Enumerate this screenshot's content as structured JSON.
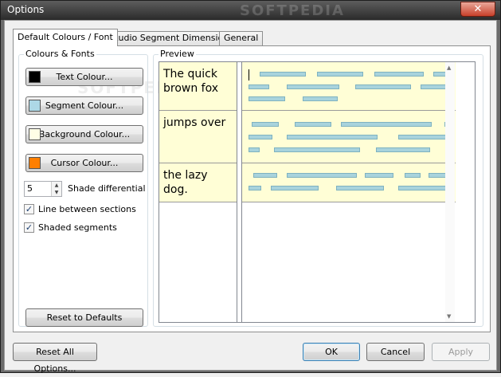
{
  "window": {
    "title": "Options",
    "close_symbol": "✕",
    "watermark": "SOFTPEDIA"
  },
  "tabs": [
    {
      "label": "Default Colours / Font",
      "active": true
    },
    {
      "label": "Audio Segment Dimensions",
      "active": false
    },
    {
      "label": "General",
      "active": false
    }
  ],
  "colours_group": {
    "label": "Colours & Fonts",
    "buttons": [
      {
        "label": "Text Colour...",
        "swatch": "#000000"
      },
      {
        "label": "Segment Colour...",
        "swatch": "#add8e6"
      },
      {
        "label": "Background Colour...",
        "swatch": "#fffee6"
      },
      {
        "label": "Cursor Colour...",
        "swatch": "#ff7f00"
      }
    ],
    "shade": {
      "value": "5",
      "label": "Shade differential",
      "up": "▲",
      "down": "▼"
    },
    "checkboxes": [
      {
        "label": "Line between sections",
        "checked": true,
        "mark": "✓"
      },
      {
        "label": "Shaded segments",
        "checked": true,
        "mark": "✓"
      }
    ],
    "reset_defaults": "Reset to Defaults"
  },
  "preview": {
    "label": "Preview",
    "lines": [
      "The quick brown fox",
      "jumps over",
      "the lazy dog."
    ],
    "scroll_up": "▲",
    "scroll_down": "▼"
  },
  "footer": {
    "reset_all": "Reset All Options...",
    "ok": "OK",
    "cancel": "Cancel",
    "apply": "Apply"
  }
}
